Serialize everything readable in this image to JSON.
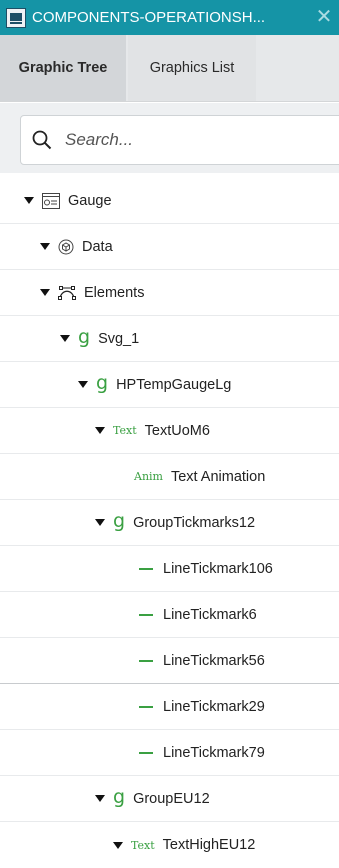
{
  "window": {
    "title": "COMPONENTS-OPERATIONSH...",
    "close_icon": "close-icon"
  },
  "tabs": [
    {
      "label": "Graphic Tree",
      "active": true
    },
    {
      "label": "Graphics List",
      "active": false
    }
  ],
  "search": {
    "placeholder": "Search...",
    "value": ""
  },
  "colors": {
    "titlebar": "#1594a6",
    "accent_green": "#3aa042"
  },
  "tree": [
    {
      "label": "Gauge",
      "icon": "graphic-icon",
      "expanded": true
    },
    {
      "label": "Data",
      "icon": "data-cube-icon",
      "expanded": true
    },
    {
      "label": "Elements",
      "icon": "elements-nodes-icon",
      "expanded": true
    },
    {
      "label": "Svg_1",
      "icon": "group-g-icon",
      "expanded": true
    },
    {
      "label": "HPTempGaugeLg",
      "icon": "group-g-icon",
      "expanded": true
    },
    {
      "label": "TextUoM6",
      "icon": "text-icon",
      "icon_text": "Text",
      "expanded": true
    },
    {
      "label": "Text Animation",
      "icon": "animation-icon",
      "icon_text": "Anim"
    },
    {
      "label": "GroupTickmarks12",
      "icon": "group-g-icon",
      "expanded": true
    },
    {
      "label": "LineTickmark106",
      "icon": "line-icon"
    },
    {
      "label": "LineTickmark6",
      "icon": "line-icon"
    },
    {
      "label": "LineTickmark56",
      "icon": "line-icon"
    },
    {
      "label": "LineTickmark29",
      "icon": "line-icon"
    },
    {
      "label": "LineTickmark79",
      "icon": "line-icon"
    },
    {
      "label": "GroupEU12",
      "icon": "group-g-icon",
      "expanded": true
    },
    {
      "label": "TextHighEU12",
      "icon": "text-icon",
      "icon_text": "Text",
      "expanded": true
    }
  ]
}
